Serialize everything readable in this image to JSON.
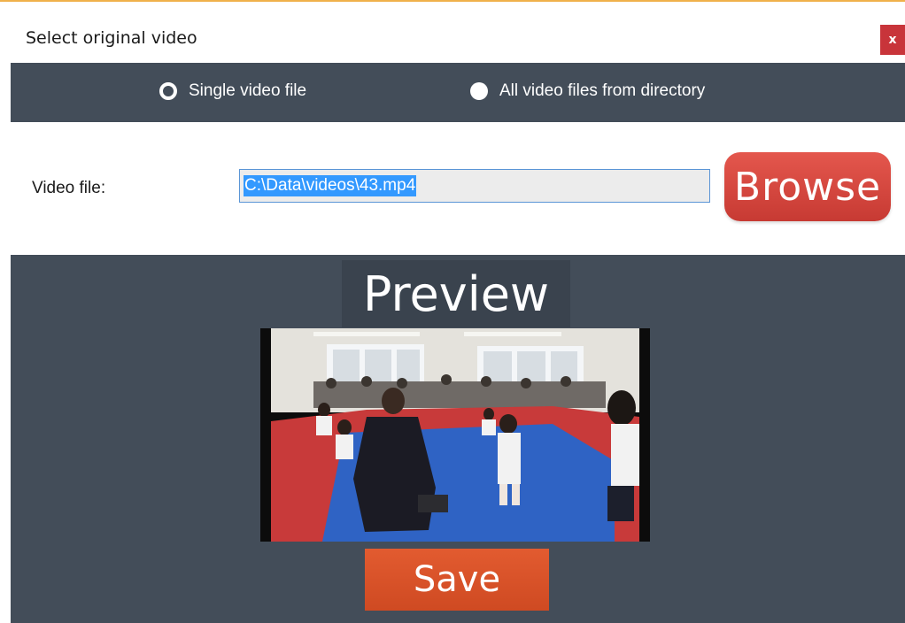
{
  "window": {
    "title": "Select original video",
    "close_label": "x"
  },
  "mode": {
    "options": [
      {
        "label": "Single video file",
        "selected": true
      },
      {
        "label": "All video files from directory",
        "selected": false
      }
    ]
  },
  "file": {
    "label": "Video file:",
    "value": "C:\\Data\\videos\\43.mp4",
    "browse_label": "Browse"
  },
  "preview": {
    "title": "Preview",
    "save_label": "Save"
  },
  "colors": {
    "panel": "#434d59",
    "browse": "#d84840",
    "save": "#d9522a",
    "close": "#c8343a",
    "accent": "#f0b14a"
  }
}
